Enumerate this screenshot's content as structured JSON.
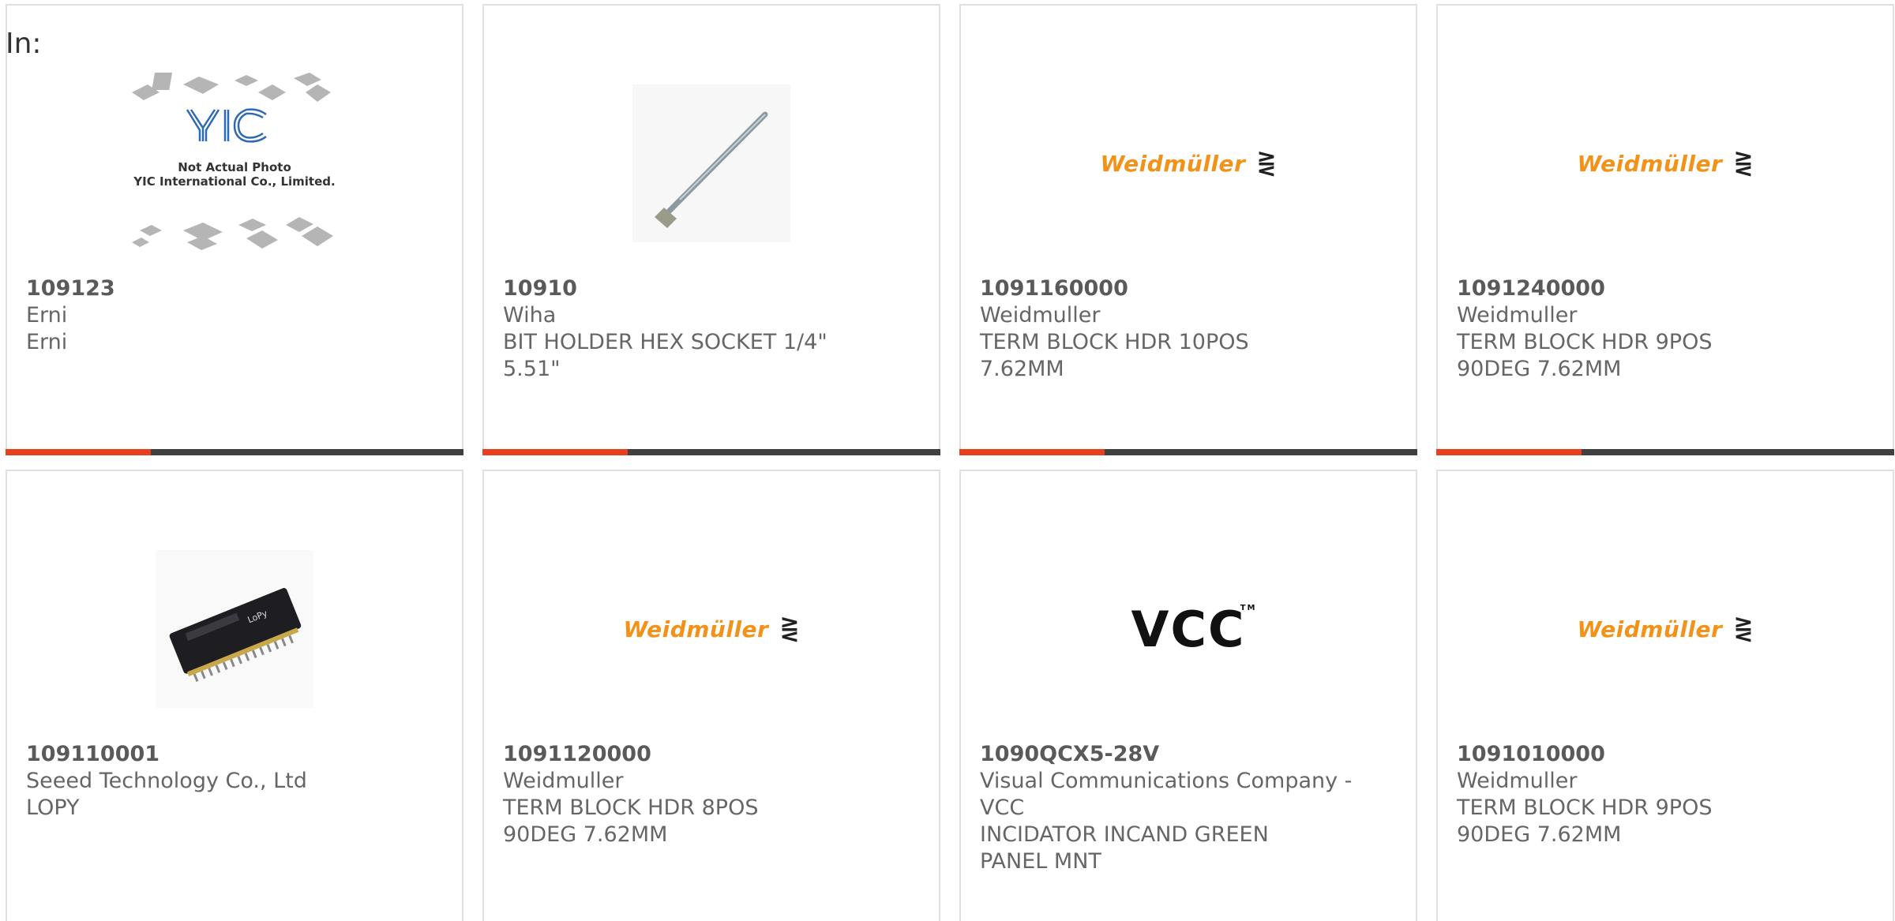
{
  "filter": {
    "label": "In:"
  },
  "colors": {
    "accent": "#e8401e",
    "bar": "#404040",
    "weidmuller": "#f29218"
  },
  "products": [
    {
      "part_number": "109123",
      "manufacturer": "Erni",
      "description": "Erni",
      "image": "yic-placeholder",
      "image_text": {
        "line1": "Not Actual Photo",
        "line2": "YIC International Co., Limited."
      }
    },
    {
      "part_number": "10910",
      "manufacturer": "Wiha",
      "description": "BIT HOLDER HEX SOCKET 1/4\" 5.51\"",
      "image": "bit-holder-photo"
    },
    {
      "part_number": "1091160000",
      "manufacturer": "Weidmuller",
      "description": "TERM BLOCK HDR 10POS 7.62MM",
      "image": "weidmuller-logo"
    },
    {
      "part_number": "1091240000",
      "manufacturer": "Weidmuller",
      "description": "TERM BLOCK HDR 9POS 90DEG 7.62MM",
      "image": "weidmuller-logo"
    },
    {
      "part_number": "109110001",
      "manufacturer": "Seeed Technology Co., Ltd",
      "description": "LOPY",
      "image": "lopy-board-photo"
    },
    {
      "part_number": "1091120000",
      "manufacturer": "Weidmuller",
      "description": "TERM BLOCK HDR 8POS 90DEG 7.62MM",
      "image": "weidmuller-logo"
    },
    {
      "part_number": "1090QCX5-28V",
      "manufacturer": "Visual Communications Company - VCC",
      "description": "INCIDATOR INCAND GREEN PANEL MNT",
      "image": "vcc-logo"
    },
    {
      "part_number": "1091010000",
      "manufacturer": "Weidmuller",
      "description": "TERM BLOCK HDR 9POS 90DEG 7.62MM",
      "image": "weidmuller-logo"
    }
  ],
  "logos": {
    "weidmuller": "Weidmüller",
    "weidmuller_mark": "⋛",
    "vcc": "VCC",
    "vcc_tm": "TM"
  }
}
